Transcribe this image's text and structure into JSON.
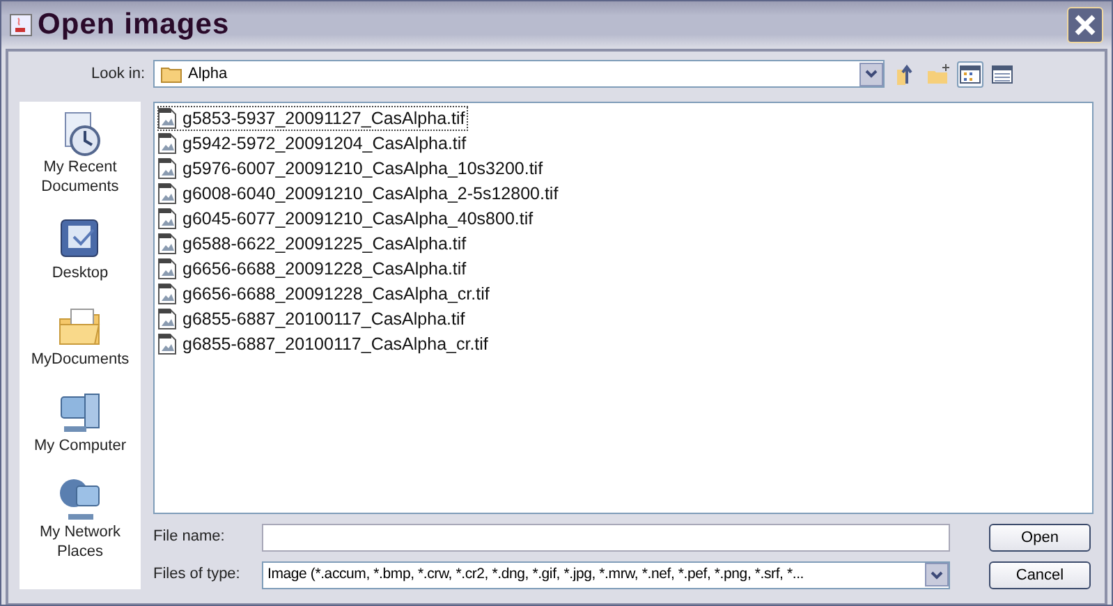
{
  "window": {
    "title": "Open images"
  },
  "look_in": {
    "label": "Look in:",
    "value": "Alpha"
  },
  "view_buttons": [
    {
      "kind": "list",
      "selected": true
    },
    {
      "kind": "details",
      "selected": false
    }
  ],
  "places": [
    {
      "kind": "recent",
      "label": "My Recent Documents"
    },
    {
      "kind": "desktop",
      "label": "Desktop"
    },
    {
      "kind": "documents",
      "label": "MyDocuments"
    },
    {
      "kind": "computer",
      "label": "My Computer"
    },
    {
      "kind": "network",
      "label": "My Network Places"
    }
  ],
  "files": [
    {
      "name": "g5853-5937_20091127_CasAlpha.tif",
      "selected": true
    },
    {
      "name": "g5942-5972_20091204_CasAlpha.tif",
      "selected": false
    },
    {
      "name": "g5976-6007_20091210_CasAlpha_10s3200.tif",
      "selected": false
    },
    {
      "name": "g6008-6040_20091210_CasAlpha_2-5s12800.tif",
      "selected": false
    },
    {
      "name": "g6045-6077_20091210_CasAlpha_40s800.tif",
      "selected": false
    },
    {
      "name": "g6588-6622_20091225_CasAlpha.tif",
      "selected": false
    },
    {
      "name": "g6656-6688_20091228_CasAlpha.tif",
      "selected": false
    },
    {
      "name": "g6656-6688_20091228_CasAlpha_cr.tif",
      "selected": false
    },
    {
      "name": "g6855-6887_20100117_CasAlpha.tif",
      "selected": false
    },
    {
      "name": "g6855-6887_20100117_CasAlpha_cr.tif",
      "selected": false
    }
  ],
  "file_name": {
    "label": "File name:"
  },
  "file_type": {
    "label": "Files of type:",
    "value": "Image (*.accum, *.bmp, *.crw, *.cr2, *.dng, *.gif, *.jpg, *.mrw, *.nef, *.pef, *.png, *.srf, *..."
  },
  "buttons": [
    "Open",
    "Cancel"
  ]
}
